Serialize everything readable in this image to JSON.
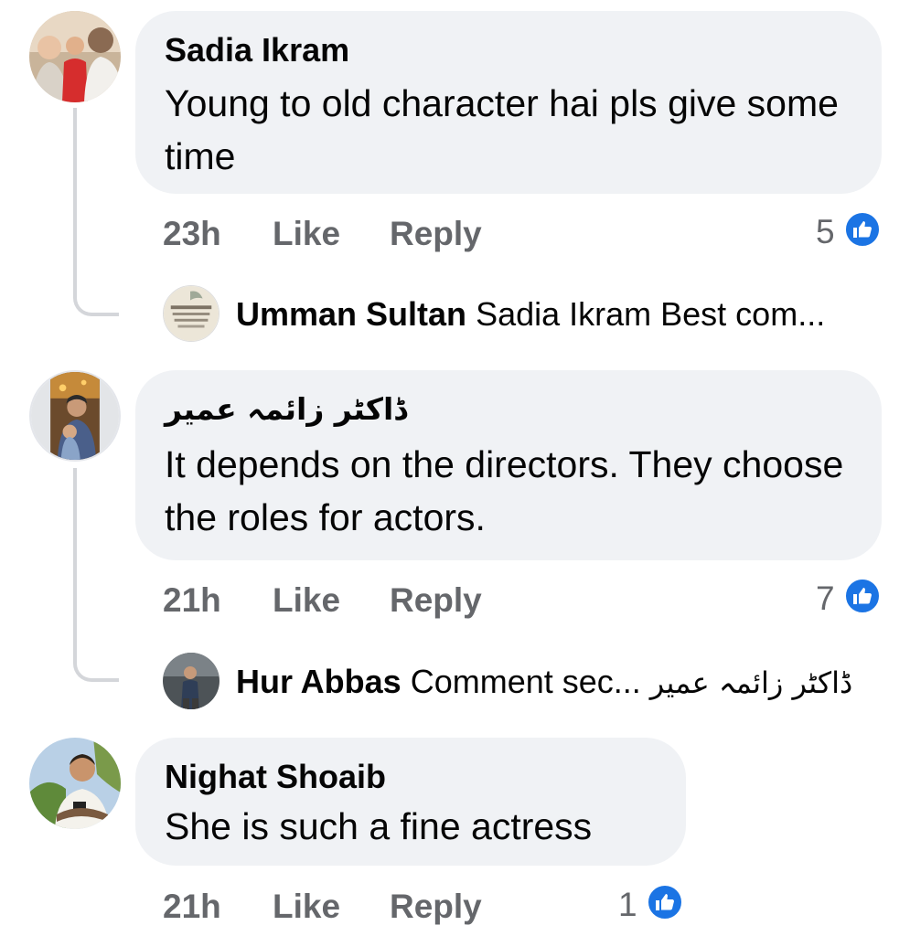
{
  "colors": {
    "bubble_bg": "#f0f2f5",
    "meta_text": "#65676b",
    "like_blue": "#1b74e4",
    "thread_line": "#d4d6da"
  },
  "comments": [
    {
      "author": "Sadia Ikram",
      "text": "Young to old character hai pls give some time",
      "time": "23h",
      "like_label": "Like",
      "reply_label": "Reply",
      "reaction_count": "5",
      "reaction_icon": "thumbs-up-icon",
      "reply_preview": {
        "author": "Umman Sultan",
        "text": "Sadia Ikram Best com..."
      }
    },
    {
      "author": "ڈاکٹر زائمہ عمیر",
      "text": "It depends on the directors. They choose the roles for actors.",
      "time": "21h",
      "like_label": "Like",
      "reply_label": "Reply",
      "reaction_count": "7",
      "reaction_icon": "thumbs-up-icon",
      "reply_preview": {
        "author": "Hur Abbas",
        "text_rtl": "ڈاکٹر زائمہ عمیر",
        "text": "Comment sec..."
      }
    },
    {
      "author": "Nighat Shoaib",
      "text": "She is such a fine actress",
      "time": "21h",
      "like_label": "Like",
      "reply_label": "Reply",
      "reaction_count": "1",
      "reaction_icon": "thumbs-up-icon"
    }
  ]
}
